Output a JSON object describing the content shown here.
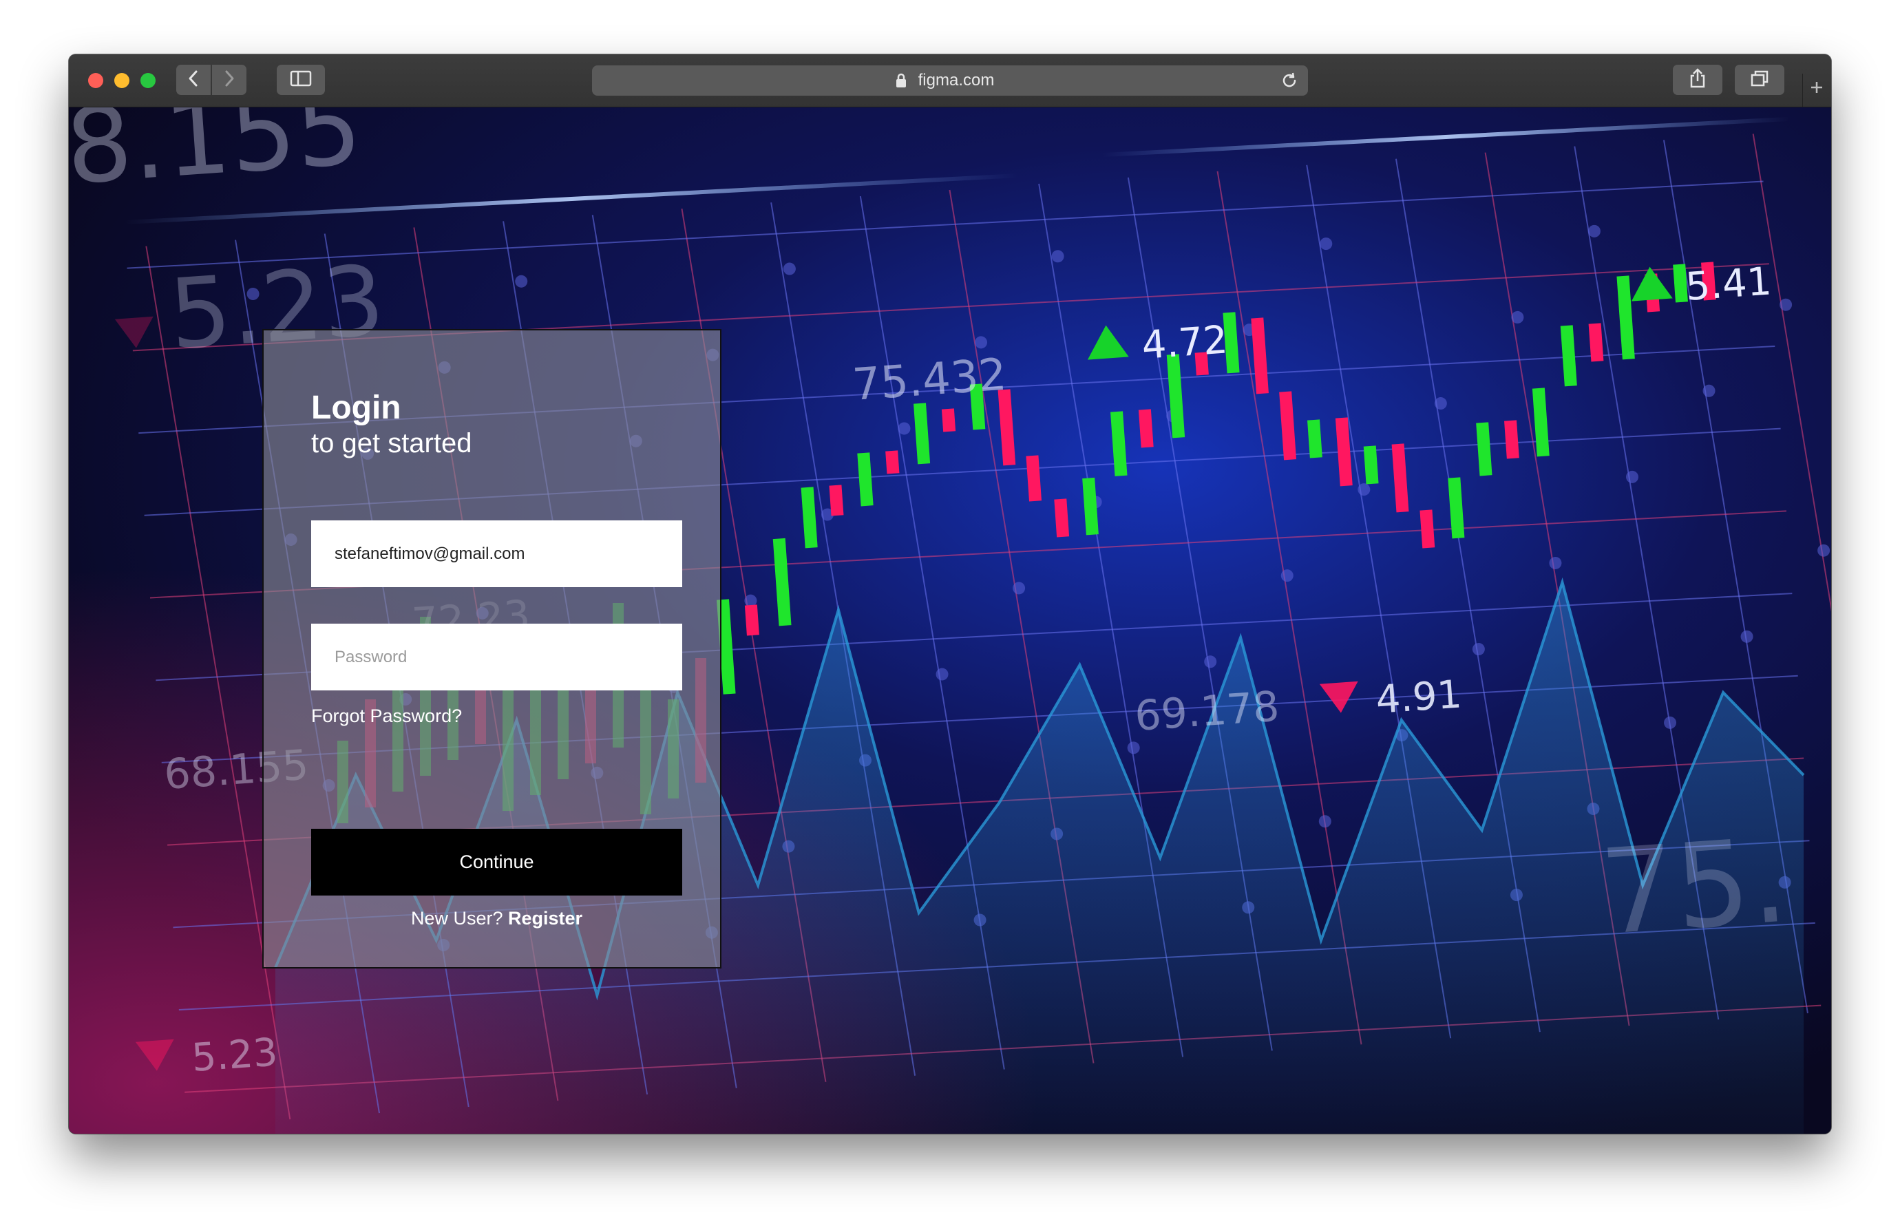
{
  "browser": {
    "url": "figma.com",
    "icons": [
      "back-icon",
      "forward-icon",
      "sidebar-icon",
      "lock-icon",
      "reload-icon",
      "share-icon",
      "tabs-icon",
      "new-tab-icon"
    ]
  },
  "background": {
    "candles": [
      {
        "o": 0.05,
        "c": 0.3
      },
      {
        "o": 0.28,
        "c": 0.2
      },
      {
        "o": 0.22,
        "c": 0.45
      },
      {
        "o": 0.42,
        "c": 0.58
      },
      {
        "o": 0.58,
        "c": 0.5
      },
      {
        "o": 0.52,
        "c": 0.66
      },
      {
        "o": 0.66,
        "c": 0.6
      },
      {
        "o": 0.62,
        "c": 0.78
      },
      {
        "o": 0.76,
        "c": 0.7
      },
      {
        "o": 0.7,
        "c": 0.82
      },
      {
        "o": 0.8,
        "c": 0.6
      },
      {
        "o": 0.62,
        "c": 0.5
      },
      {
        "o": 0.5,
        "c": 0.4
      },
      {
        "o": 0.4,
        "c": 0.55
      },
      {
        "o": 0.55,
        "c": 0.72
      },
      {
        "o": 0.72,
        "c": 0.62
      },
      {
        "o": 0.64,
        "c": 0.86
      },
      {
        "o": 0.86,
        "c": 0.8
      },
      {
        "o": 0.8,
        "c": 0.96
      },
      {
        "o": 0.94,
        "c": 0.74
      },
      {
        "o": 0.74,
        "c": 0.56
      },
      {
        "o": 0.56,
        "c": 0.66
      },
      {
        "o": 0.66,
        "c": 0.48
      },
      {
        "o": 0.48,
        "c": 0.58
      },
      {
        "o": 0.58,
        "c": 0.4
      },
      {
        "o": 0.4,
        "c": 0.3
      },
      {
        "o": 0.32,
        "c": 0.48
      },
      {
        "o": 0.48,
        "c": 0.62
      },
      {
        "o": 0.62,
        "c": 0.52
      },
      {
        "o": 0.52,
        "c": 0.7
      },
      {
        "o": 0.7,
        "c": 0.86
      },
      {
        "o": 0.86,
        "c": 0.76
      },
      {
        "o": 0.76,
        "c": 0.98
      },
      {
        "o": 0.98,
        "c": 0.88
      },
      {
        "o": 0.9,
        "c": 1.0
      },
      {
        "o": 1.0,
        "c": 0.9
      }
    ],
    "area_line": [
      0.1,
      0.45,
      0.15,
      0.55,
      0.05,
      0.6,
      0.25,
      0.75,
      0.2,
      0.4,
      0.65,
      0.3,
      0.7,
      0.15,
      0.55,
      0.35,
      0.8,
      0.25,
      0.6,
      0.45
    ],
    "labels": [
      {
        "text": "5.41",
        "direction": "up"
      },
      {
        "text": "4.72",
        "direction": "up"
      },
      {
        "text": "75.432",
        "direction": "none"
      },
      {
        "text": "69.178",
        "direction": "none"
      },
      {
        "text": "4.91",
        "direction": "down"
      },
      {
        "text": "68.155",
        "direction": "none"
      },
      {
        "text": "5.23",
        "direction": "down"
      },
      {
        "text": "8.155",
        "direction": "none"
      },
      {
        "text": "5.23",
        "direction": "down"
      },
      {
        "text": "72.23",
        "direction": "none"
      },
      {
        "text": "75.",
        "direction": "none"
      }
    ],
    "colors": {
      "up": "#1fe52c",
      "down": "#ff1760",
      "grid_blue": "#6a72f0",
      "grid_pink": "#e0407a",
      "area": "#2a9ad8"
    }
  },
  "login": {
    "title": "Login",
    "subtitle": "to get started",
    "email_value": "stefaneftimov@gmail.com",
    "password_placeholder": "Password",
    "forgot_label": "Forgot Password?",
    "continue_label": "Continue",
    "new_user_label": "New User?",
    "register_label": "Register"
  }
}
